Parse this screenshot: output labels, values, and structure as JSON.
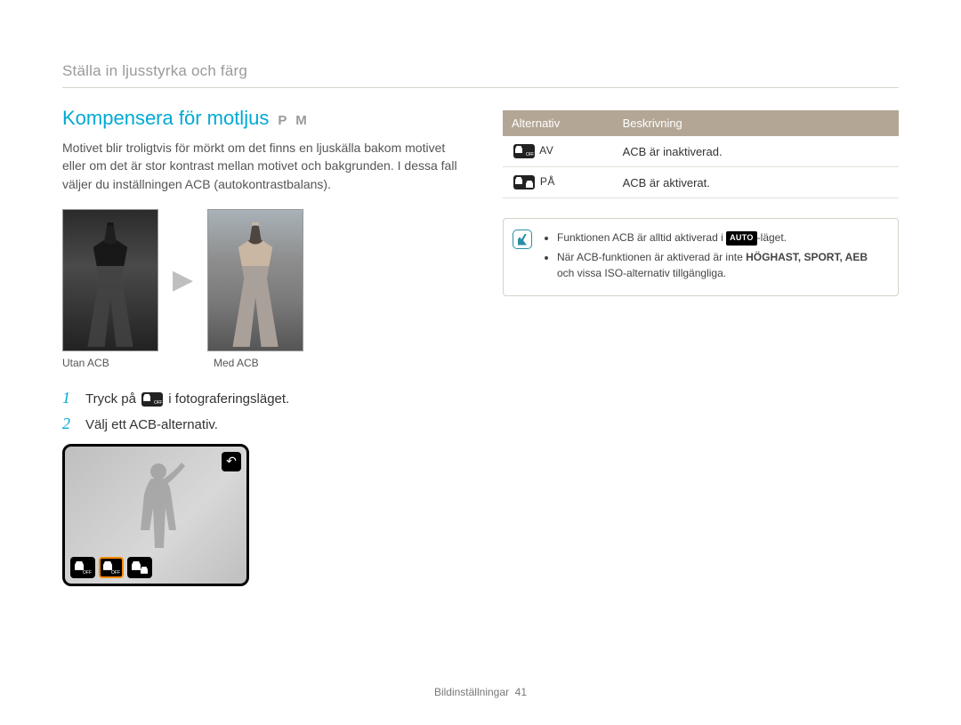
{
  "breadcrumb": "Ställa in ljusstyrka och färg",
  "section": {
    "title": "Kompensera för motljus",
    "modes": "P M",
    "body": "Motivet blir troligtvis för mörkt om det finns en ljuskälla bakom motivet eller om det är stor kontrast mellan motivet och bakgrunden. I dessa fall väljer du inställningen ACB (autokontrastbalans).",
    "compare": {
      "left_caption": "Utan ACB",
      "right_caption": "Med ACB"
    },
    "steps": [
      {
        "num": "1",
        "pre": "Tryck på ",
        "post": " i fotograferingsläget."
      },
      {
        "num": "2",
        "text": "Välj ett ACB-alternativ."
      }
    ]
  },
  "options_table": {
    "header_alt": "Alternativ",
    "header_desc": "Beskrivning",
    "rows": [
      {
        "label": "AV",
        "icon": "off",
        "desc": "ACB är inaktiverad."
      },
      {
        "label": "PÅ",
        "icon": "on",
        "desc": "ACB är aktiverat."
      }
    ]
  },
  "note": {
    "items": [
      {
        "pre": "Funktionen ACB är alltid aktiverad i ",
        "badge": "AUTO",
        "post": "-läget."
      },
      {
        "pre": "När ACB-funktionen är aktiverad är inte ",
        "bold": "HÖGHAST, SPORT, AEB",
        "post": " och vissa ISO-alternativ tillgängliga."
      }
    ]
  },
  "footer": {
    "section": "Bildinställningar",
    "page": "41"
  }
}
